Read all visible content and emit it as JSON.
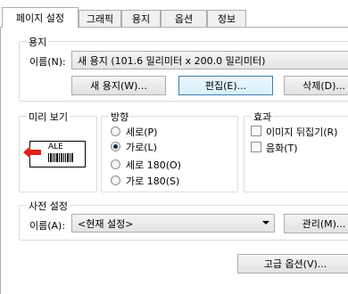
{
  "tabs": [
    "페이지 설정",
    "그래픽",
    "용지",
    "옵션",
    "정보"
  ],
  "paper": {
    "group_title": "용지",
    "name_label": "이름(N):",
    "name_value": "새 용지 (101.6 밀리미터 x 200.0 밀리미터)",
    "new_button": "새 용지(W)...",
    "edit_button": "편집(E)...",
    "delete_button": "삭제(D)..."
  },
  "preview": {
    "group_title": "미리 보기",
    "sample_text": "ALE",
    "arrow_color": "#e0201a"
  },
  "orientation": {
    "group_title": "방향",
    "options": [
      "세로(P)",
      "가로(L)",
      "세로 180(O)",
      "가로 180(S)"
    ],
    "selected": "가로(L)"
  },
  "effects": {
    "group_title": "효과",
    "mirror": "이미지 뒤집기(R)",
    "negative": "음화(T)"
  },
  "presets": {
    "group_title": "사전 설정",
    "name_label": "이름(A):",
    "name_value": "<현재 설정>",
    "manage_button": "관리(M)..."
  },
  "advanced_button": "고급 옵션(V)..."
}
